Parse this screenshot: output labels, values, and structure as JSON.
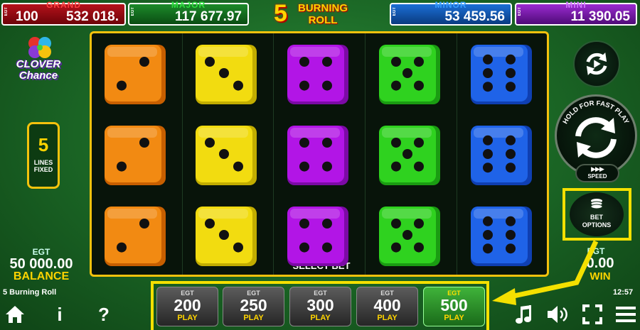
{
  "jackpots": {
    "grand": {
      "label": "GRAND",
      "egt": "EGT",
      "prefix": "100",
      "value": "532 018."
    },
    "major": {
      "label": "MAJOR",
      "egt": "EGT",
      "value": "117 677.97"
    },
    "minor": {
      "label": "MINOR",
      "egt": "EGT",
      "value": "53 459.56"
    },
    "mini": {
      "label": "MINI",
      "egt": "EGT",
      "value": "11 390.05"
    }
  },
  "title": {
    "number": "5",
    "line1": "BURNING",
    "line2": "ROLL"
  },
  "logo": {
    "line1": "CLOVER",
    "line2": "Chance"
  },
  "lines": {
    "count": "5",
    "line1": "LINES",
    "line2": "FIXED"
  },
  "reels": {
    "colors": [
      "#f28a12",
      "#f2dc10",
      "#b215e6",
      "#2fd21f",
      "#1f63e8"
    ],
    "shades": [
      "#c75f00",
      "#c2ad00",
      "#7c0aa6",
      "#1a9c12",
      "#0f3fb2"
    ],
    "pips": [
      2,
      3,
      4,
      5,
      6
    ],
    "select_bet_label": "SELECT BET"
  },
  "balance": {
    "egt": "EGT",
    "value": "50 000.00",
    "label": "BALANCE"
  },
  "game_name": "5 Burning Roll",
  "win": {
    "egt": "EGT",
    "value": "0.00",
    "label": "WIN"
  },
  "clock": "12:57",
  "controls": {
    "hold_text": "HOLD FOR FAST PLAY",
    "speed_label": "SPEED",
    "speed_arrows": "▶▶▶",
    "bet_options_line1": "BET",
    "bet_options_line2": "OPTIONS"
  },
  "bets": [
    {
      "egt": "EGT",
      "value": "200",
      "play": "PLAY",
      "active": false
    },
    {
      "egt": "EGT",
      "value": "250",
      "play": "PLAY",
      "active": false
    },
    {
      "egt": "EGT",
      "value": "300",
      "play": "PLAY",
      "active": false
    },
    {
      "egt": "EGT",
      "value": "400",
      "play": "PLAY",
      "active": false
    },
    {
      "egt": "EGT",
      "value": "500",
      "play": "PLAY",
      "active": true
    }
  ],
  "bottom_icons": {
    "home": "home-icon",
    "info": "i",
    "help": "?",
    "music": "music-icon",
    "sound": "speaker-icon",
    "fullscreen": "fullscreen-icon",
    "menu": "menu-icon"
  },
  "highlight_color": "#f4e000"
}
